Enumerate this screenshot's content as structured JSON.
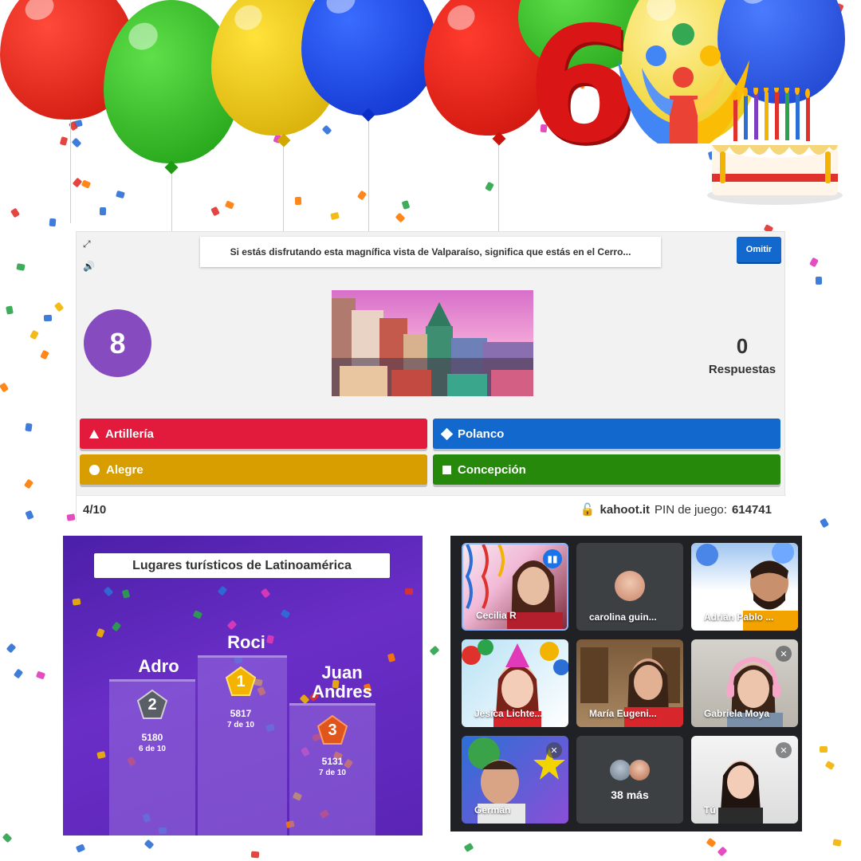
{
  "kahoot": {
    "question": "Si estás disfrutando esta magnífica vista de Valparaíso, significa que estás en el Cerro...",
    "skip_label": "Omitir",
    "timer": "8",
    "answers_count": "0",
    "answers_label": "Respuestas",
    "answers": [
      {
        "label": "Artillería",
        "shape": "triangle",
        "color": "#e21b3c"
      },
      {
        "label": "Polanco",
        "shape": "diamond",
        "color": "#1368ce"
      },
      {
        "label": "Alegre",
        "shape": "circle",
        "color": "#d89e00"
      },
      {
        "label": "Concepción",
        "shape": "square",
        "color": "#26890c"
      }
    ],
    "progress": "4/10",
    "site": "kahoot.it",
    "pin_label": "PIN de juego:",
    "pin": "614741"
  },
  "podium": {
    "title": "Lugares turísticos de Latinoamérica",
    "places": [
      {
        "rank": "1",
        "name": "Roci",
        "score": "5817",
        "correct": "7 de 10"
      },
      {
        "rank": "2",
        "name": "Adro",
        "score": "5180",
        "correct": "6 de 10"
      },
      {
        "rank": "3",
        "name": "Juan Andres",
        "score": "5131",
        "correct": "7 de 10"
      }
    ]
  },
  "meet": {
    "participants": [
      {
        "name": "Cecilia R"
      },
      {
        "name": "carolina guin..."
      },
      {
        "name": "Adrián Pablo ..."
      },
      {
        "name": "Jesica Lichte..."
      },
      {
        "name": "María Eugeni..."
      },
      {
        "name": "Gabriela Moya"
      },
      {
        "name": "Germán"
      },
      {
        "name": "38 más"
      },
      {
        "name": "Tú"
      }
    ]
  },
  "decor": {
    "number": "6"
  }
}
